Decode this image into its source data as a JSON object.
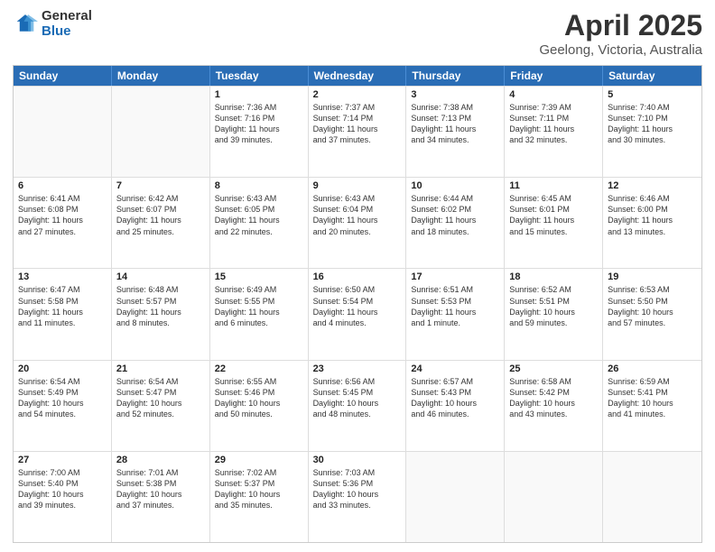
{
  "logo": {
    "general": "General",
    "blue": "Blue"
  },
  "title": "April 2025",
  "subtitle": "Geelong, Victoria, Australia",
  "headers": [
    "Sunday",
    "Monday",
    "Tuesday",
    "Wednesday",
    "Thursday",
    "Friday",
    "Saturday"
  ],
  "weeks": [
    [
      {
        "day": "",
        "info": ""
      },
      {
        "day": "",
        "info": ""
      },
      {
        "day": "1",
        "info": "Sunrise: 7:36 AM\nSunset: 7:16 PM\nDaylight: 11 hours\nand 39 minutes."
      },
      {
        "day": "2",
        "info": "Sunrise: 7:37 AM\nSunset: 7:14 PM\nDaylight: 11 hours\nand 37 minutes."
      },
      {
        "day": "3",
        "info": "Sunrise: 7:38 AM\nSunset: 7:13 PM\nDaylight: 11 hours\nand 34 minutes."
      },
      {
        "day": "4",
        "info": "Sunrise: 7:39 AM\nSunset: 7:11 PM\nDaylight: 11 hours\nand 32 minutes."
      },
      {
        "day": "5",
        "info": "Sunrise: 7:40 AM\nSunset: 7:10 PM\nDaylight: 11 hours\nand 30 minutes."
      }
    ],
    [
      {
        "day": "6",
        "info": "Sunrise: 6:41 AM\nSunset: 6:08 PM\nDaylight: 11 hours\nand 27 minutes."
      },
      {
        "day": "7",
        "info": "Sunrise: 6:42 AM\nSunset: 6:07 PM\nDaylight: 11 hours\nand 25 minutes."
      },
      {
        "day": "8",
        "info": "Sunrise: 6:43 AM\nSunset: 6:05 PM\nDaylight: 11 hours\nand 22 minutes."
      },
      {
        "day": "9",
        "info": "Sunrise: 6:43 AM\nSunset: 6:04 PM\nDaylight: 11 hours\nand 20 minutes."
      },
      {
        "day": "10",
        "info": "Sunrise: 6:44 AM\nSunset: 6:02 PM\nDaylight: 11 hours\nand 18 minutes."
      },
      {
        "day": "11",
        "info": "Sunrise: 6:45 AM\nSunset: 6:01 PM\nDaylight: 11 hours\nand 15 minutes."
      },
      {
        "day": "12",
        "info": "Sunrise: 6:46 AM\nSunset: 6:00 PM\nDaylight: 11 hours\nand 13 minutes."
      }
    ],
    [
      {
        "day": "13",
        "info": "Sunrise: 6:47 AM\nSunset: 5:58 PM\nDaylight: 11 hours\nand 11 minutes."
      },
      {
        "day": "14",
        "info": "Sunrise: 6:48 AM\nSunset: 5:57 PM\nDaylight: 11 hours\nand 8 minutes."
      },
      {
        "day": "15",
        "info": "Sunrise: 6:49 AM\nSunset: 5:55 PM\nDaylight: 11 hours\nand 6 minutes."
      },
      {
        "day": "16",
        "info": "Sunrise: 6:50 AM\nSunset: 5:54 PM\nDaylight: 11 hours\nand 4 minutes."
      },
      {
        "day": "17",
        "info": "Sunrise: 6:51 AM\nSunset: 5:53 PM\nDaylight: 11 hours\nand 1 minute."
      },
      {
        "day": "18",
        "info": "Sunrise: 6:52 AM\nSunset: 5:51 PM\nDaylight: 10 hours\nand 59 minutes."
      },
      {
        "day": "19",
        "info": "Sunrise: 6:53 AM\nSunset: 5:50 PM\nDaylight: 10 hours\nand 57 minutes."
      }
    ],
    [
      {
        "day": "20",
        "info": "Sunrise: 6:54 AM\nSunset: 5:49 PM\nDaylight: 10 hours\nand 54 minutes."
      },
      {
        "day": "21",
        "info": "Sunrise: 6:54 AM\nSunset: 5:47 PM\nDaylight: 10 hours\nand 52 minutes."
      },
      {
        "day": "22",
        "info": "Sunrise: 6:55 AM\nSunset: 5:46 PM\nDaylight: 10 hours\nand 50 minutes."
      },
      {
        "day": "23",
        "info": "Sunrise: 6:56 AM\nSunset: 5:45 PM\nDaylight: 10 hours\nand 48 minutes."
      },
      {
        "day": "24",
        "info": "Sunrise: 6:57 AM\nSunset: 5:43 PM\nDaylight: 10 hours\nand 46 minutes."
      },
      {
        "day": "25",
        "info": "Sunrise: 6:58 AM\nSunset: 5:42 PM\nDaylight: 10 hours\nand 43 minutes."
      },
      {
        "day": "26",
        "info": "Sunrise: 6:59 AM\nSunset: 5:41 PM\nDaylight: 10 hours\nand 41 minutes."
      }
    ],
    [
      {
        "day": "27",
        "info": "Sunrise: 7:00 AM\nSunset: 5:40 PM\nDaylight: 10 hours\nand 39 minutes."
      },
      {
        "day": "28",
        "info": "Sunrise: 7:01 AM\nSunset: 5:38 PM\nDaylight: 10 hours\nand 37 minutes."
      },
      {
        "day": "29",
        "info": "Sunrise: 7:02 AM\nSunset: 5:37 PM\nDaylight: 10 hours\nand 35 minutes."
      },
      {
        "day": "30",
        "info": "Sunrise: 7:03 AM\nSunset: 5:36 PM\nDaylight: 10 hours\nand 33 minutes."
      },
      {
        "day": "",
        "info": ""
      },
      {
        "day": "",
        "info": ""
      },
      {
        "day": "",
        "info": ""
      }
    ]
  ]
}
